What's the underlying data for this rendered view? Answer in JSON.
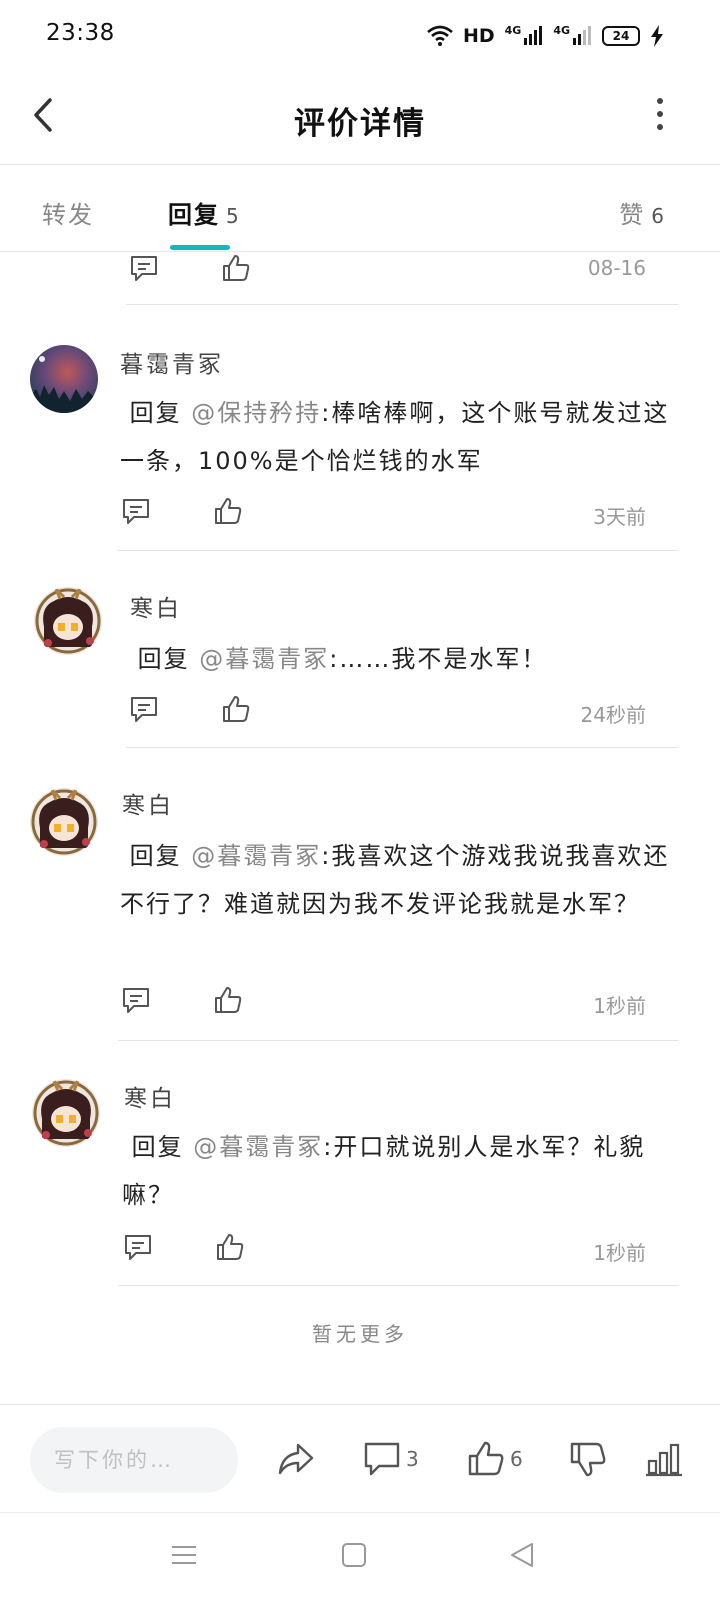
{
  "status_bar": {
    "time": "23:38",
    "hd": "HD",
    "net1": "4G",
    "net2": "4G",
    "battery": "24"
  },
  "header": {
    "title": "评价详情"
  },
  "tabs": {
    "forward": {
      "label": "转发"
    },
    "reply": {
      "label": "回复",
      "count": "5"
    },
    "like": {
      "label": "赞",
      "count": "6"
    }
  },
  "partial_item": {
    "time": "08-16"
  },
  "comments": [
    {
      "name": "暮霭青冢",
      "reply_prefix": "回复",
      "mention": "@保持矜持",
      "text": ":棒啥棒啊，这个账号就发过这一条，100%是个恰烂钱的水军",
      "time": "3天前"
    },
    {
      "name": "寒白",
      "reply_prefix": "回复",
      "mention": "@暮霭青冢",
      "text": ":……我不是水军！",
      "time": "24秒前"
    },
    {
      "name": "寒白",
      "reply_prefix": "回复",
      "mention": "@暮霭青冢",
      "text": ":我喜欢这个游戏我说我喜欢还不行了？难道就因为我不发评论我就是水军？",
      "time": "1秒前"
    },
    {
      "name": "寒白",
      "reply_prefix": "回复",
      "mention": "@暮霭青冢",
      "text": ":开口就说别人是水军？礼貌嘛？",
      "time": "1秒前"
    }
  ],
  "footer": {
    "no_more": "暂无更多"
  },
  "bottom_bar": {
    "placeholder": "写下你的…",
    "comment_count": "3",
    "like_count": "6"
  },
  "colors": {
    "accent": "#19b4c0"
  }
}
